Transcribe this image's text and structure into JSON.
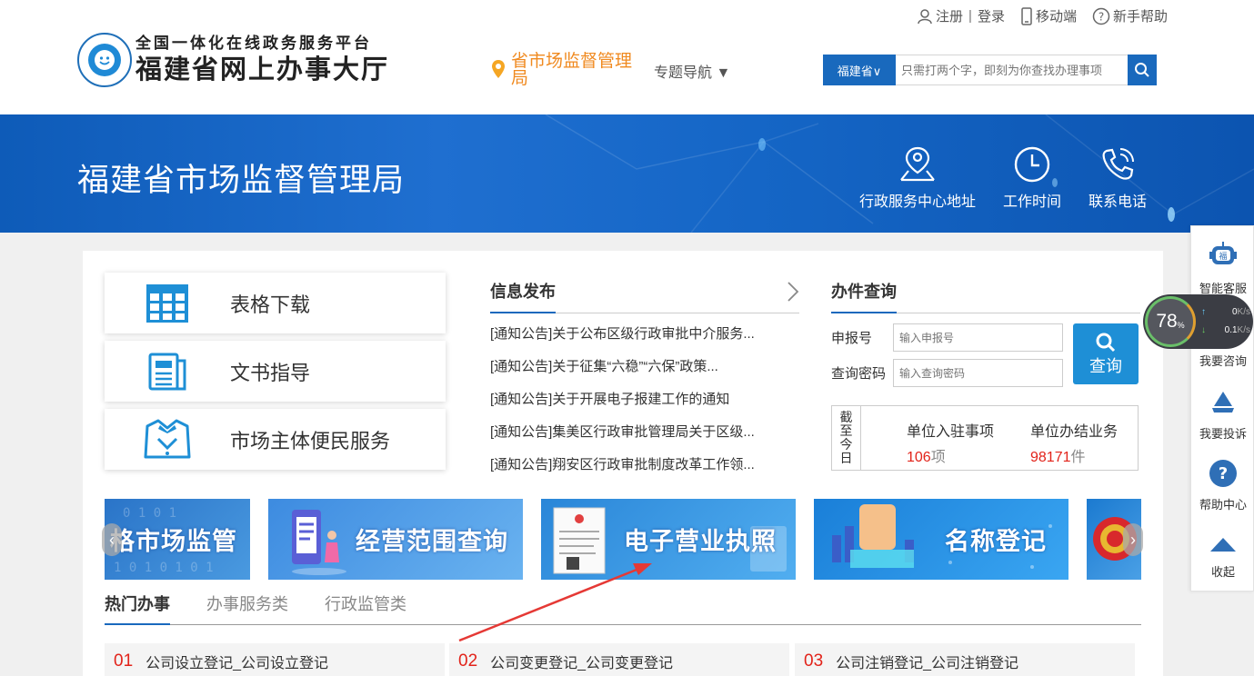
{
  "header": {
    "register": "注册",
    "login": "登录",
    "mobile": "移动端",
    "help": "新手帮助",
    "logo_line1": "全国一体化在线政务服务平台",
    "logo_line2": "福建省网上办事大厅",
    "location": "省市场监督管理局",
    "topic_nav": "专题导航 ▼",
    "search_region": "福建省∨",
    "search_placeholder": "只需打两个字，即刻为你查找办理事项"
  },
  "banner": {
    "title": "福建省市场监督管理局",
    "icons": [
      {
        "label": "行政服务中心地址",
        "icon": "location-person-icon"
      },
      {
        "label": "工作时间",
        "icon": "clock-icon"
      },
      {
        "label": "联系电话",
        "icon": "phone-icon"
      }
    ]
  },
  "services": [
    {
      "label": "表格下载",
      "icon": "table-icon"
    },
    {
      "label": "文书指导",
      "icon": "document-icon"
    },
    {
      "label": "市场主体便民服务",
      "icon": "service-person-icon"
    }
  ],
  "news": {
    "title": "信息发布",
    "items": [
      "[通知公告]关于公布区级行政审批中介服务...",
      "[通知公告]关于征集“六稳”“六保”政策...",
      "[通知公告]关于开展电子报建工作的通知",
      "[通知公告]集美区行政审批管理局关于区级...",
      "[通知公告]翔安区行政审批制度改革工作领..."
    ]
  },
  "query": {
    "title": "办件查询",
    "apply_label": "申报号",
    "apply_placeholder": "输入申报号",
    "pwd_label": "查询密码",
    "pwd_placeholder": "输入查询密码",
    "button": "查询",
    "stats_label": "截至今日",
    "stat1_label": "单位入驻事项",
    "stat1_value": "106",
    "stat1_unit": "项",
    "stat2_label": "单位办结业务",
    "stat2_value": "98171",
    "stat2_unit": "件"
  },
  "carousel": {
    "slides": [
      "格市场监管",
      "经营范围查询",
      "电子营业执照",
      "名称登记",
      ""
    ],
    "prev": "‹",
    "next": "›"
  },
  "tabs": [
    "热门办事",
    "办事服务类",
    "行政监管类"
  ],
  "hot_items": [
    {
      "num": "01",
      "text": "公司设立登记_公司设立登记"
    },
    {
      "num": "02",
      "text": "公司变更登记_公司变更登记"
    },
    {
      "num": "03",
      "text": "公司注销登记_公司注销登记"
    }
  ],
  "floatbar": {
    "items": [
      "智能客服",
      "我要咨询",
      "我要投诉",
      "帮助中心",
      "收起"
    ]
  },
  "speed": {
    "percent": "78",
    "pct_sign": "%",
    "up": "0",
    "up_unit": "K/s",
    "down": "0.1",
    "down_unit": "K/s"
  },
  "colors": {
    "brand_blue": "#1969bd",
    "accent_orange": "#f08a20",
    "red": "#e2231a"
  }
}
